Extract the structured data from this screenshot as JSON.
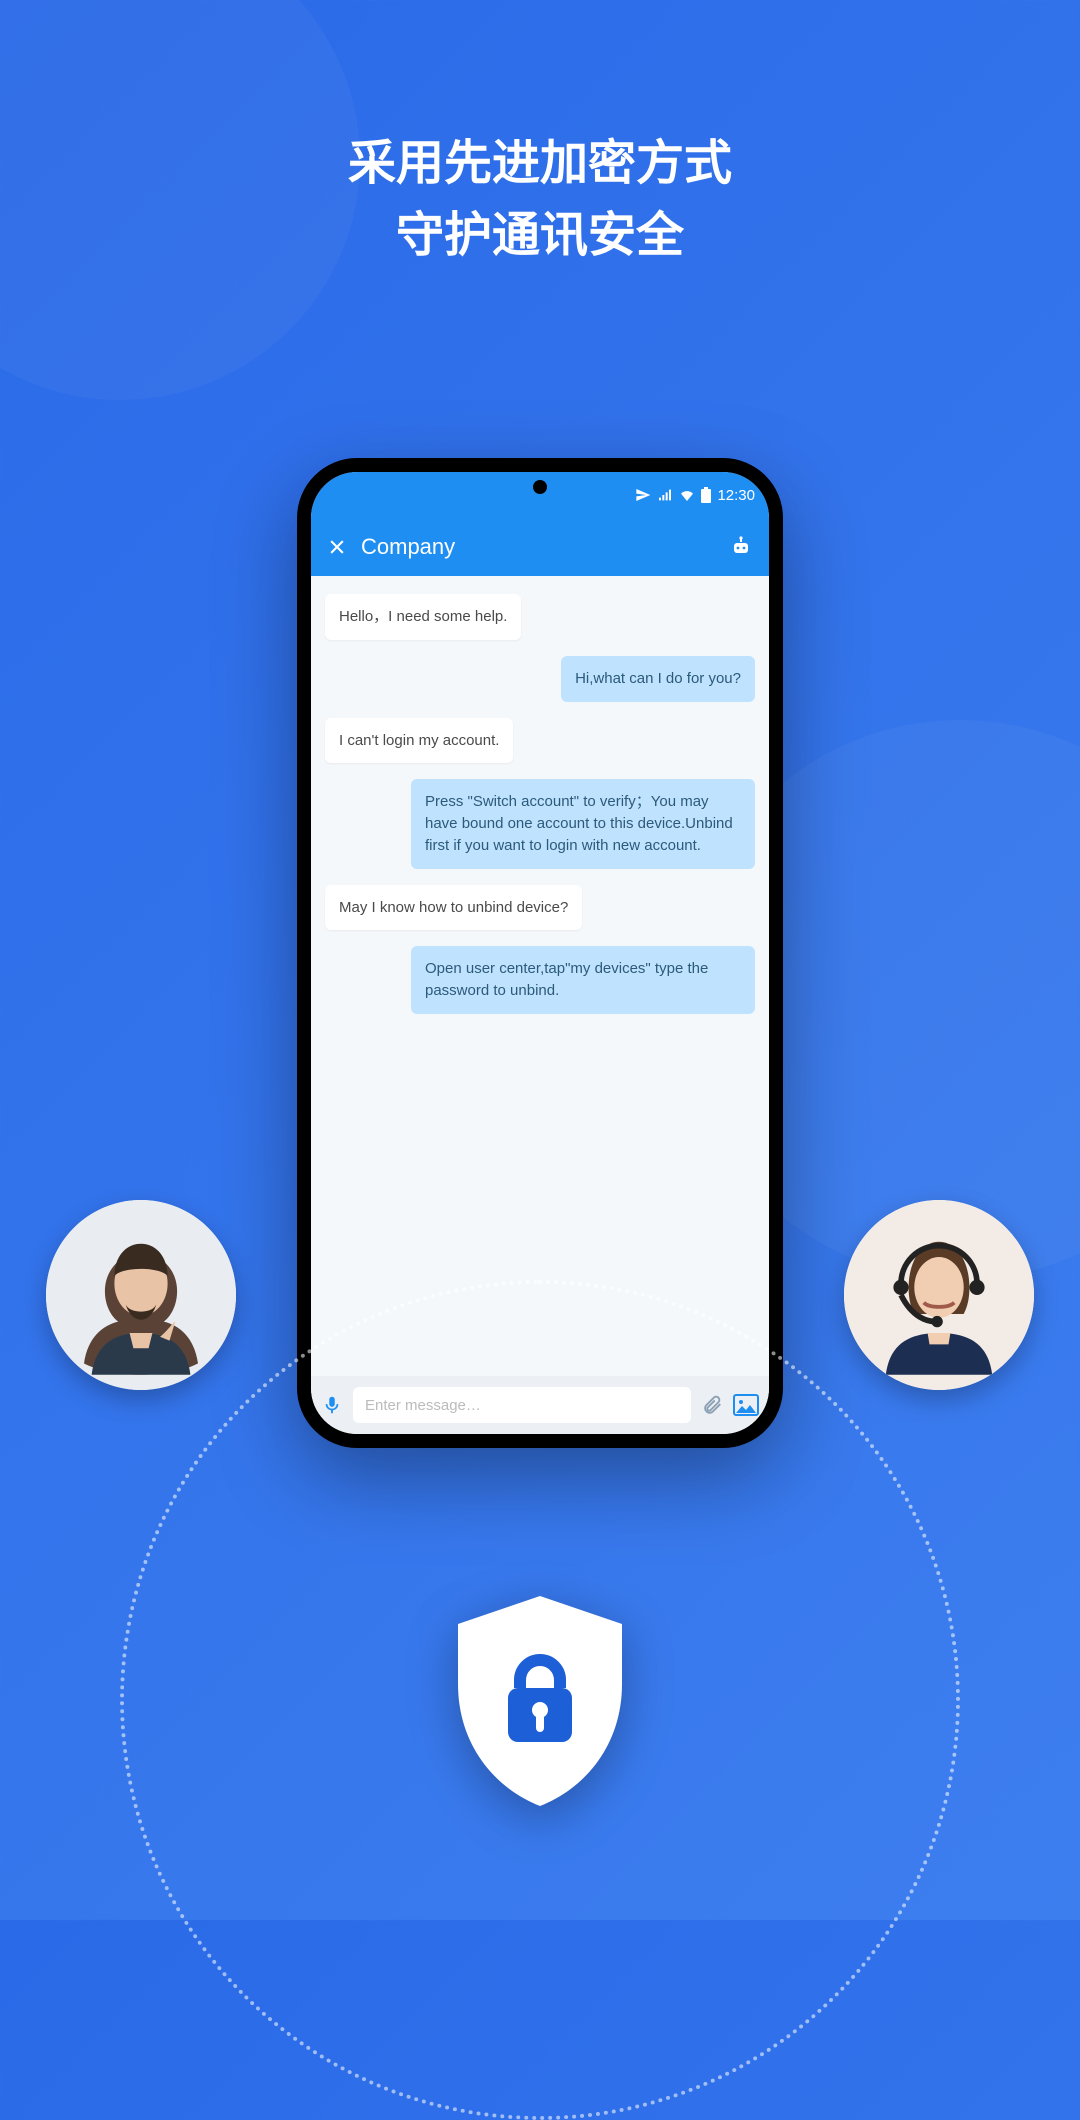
{
  "headline": {
    "line1": "采用先进加密方式",
    "line2": "守护通讯安全"
  },
  "statusbar": {
    "time": "12:30"
  },
  "chat": {
    "title": "Company",
    "messages": [
      {
        "side": "left",
        "text": "Hello，I need some help."
      },
      {
        "side": "right",
        "text": "Hi,what can I do for you?"
      },
      {
        "side": "left",
        "text": "I can't login my account."
      },
      {
        "side": "right",
        "text": "Press \"Switch account\" to verify；You may have bound one account to this device.Unbind first if you want to login with new account."
      },
      {
        "side": "left",
        "text": "May I know how to unbind device?"
      },
      {
        "side": "right",
        "text": "Open user center,tap\"my devices\" type the password to unbind."
      }
    ],
    "input_placeholder": "Enter message…"
  },
  "icons": {
    "close": "close-icon",
    "robot": "robot-icon",
    "mic": "mic-icon",
    "attach": "attach-icon",
    "image": "image-icon",
    "shield": "shield-lock-icon",
    "signal": "signal-icon",
    "wifi": "wifi-icon",
    "battery": "battery-icon",
    "paper_plane": "paper-plane-icon"
  },
  "avatars": {
    "left": "male-user-avatar",
    "right": "female-agent-headset-avatar"
  }
}
